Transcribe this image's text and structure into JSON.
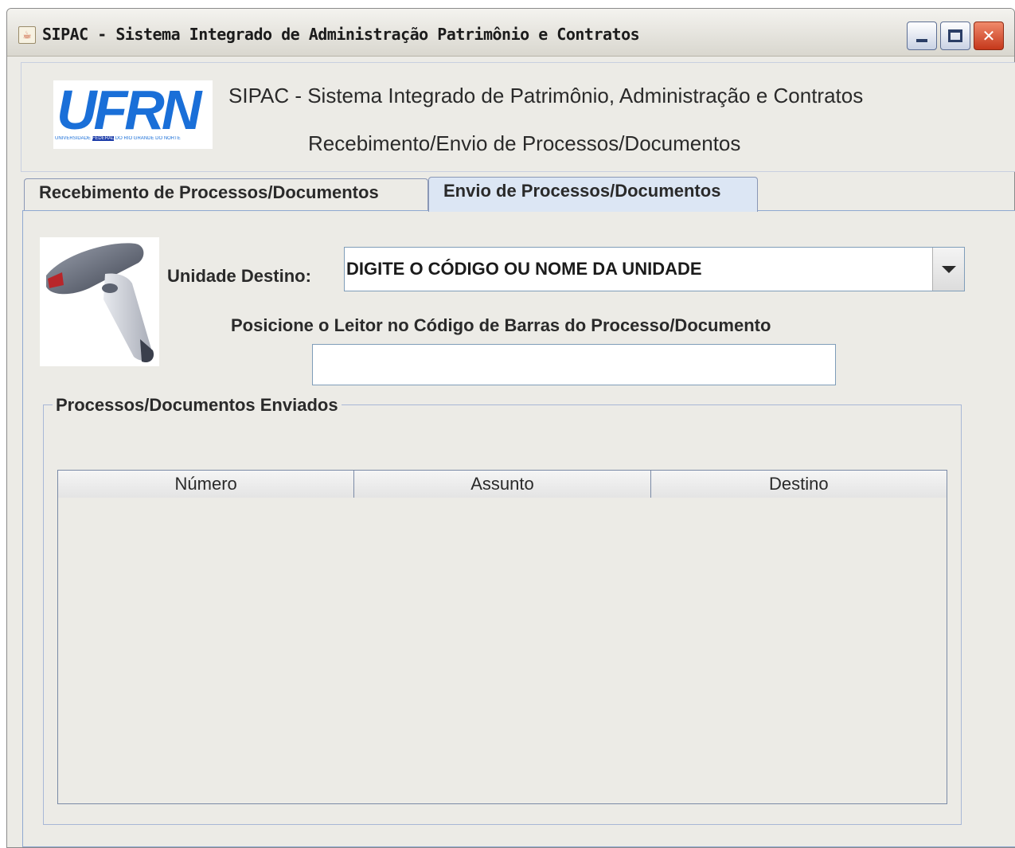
{
  "window": {
    "title": "SIPAC - Sistema Integrado de Administração Patrimônio e Contratos",
    "icon": "java-cup-icon"
  },
  "header": {
    "logo_text": "UFRN",
    "logo_subtext_pre": "UNIVERSIDADE ",
    "logo_subtext_highlight": "FEDERAL",
    "logo_subtext_post": " DO RIO GRANDE DO NORTE",
    "title": "SIPAC - Sistema Integrado de Patrimônio, Administração e Contratos",
    "subtitle": "Recebimento/Envio de Processos/Documentos"
  },
  "tabs": [
    {
      "label": "Recebimento de Processos/Documentos",
      "selected": false
    },
    {
      "label": "Envio de Processos/Documentos",
      "selected": true
    }
  ],
  "form": {
    "unidade_label": "Unidade Destino:",
    "unidade_value": "DIGITE O CÓDIGO OU NOME DA UNIDADE",
    "barcode_label": "Posicione o Leitor no Código de Barras do Processo/Documento",
    "barcode_value": ""
  },
  "sent": {
    "group_title": "Processos/Documentos Enviados",
    "columns": [
      "Número",
      "Assunto",
      "Destino"
    ],
    "rows": []
  },
  "colors": {
    "logo_blue": "#1a6fd8",
    "selected_tab": "#dce6f4",
    "window_bg": "#ecebe6"
  }
}
